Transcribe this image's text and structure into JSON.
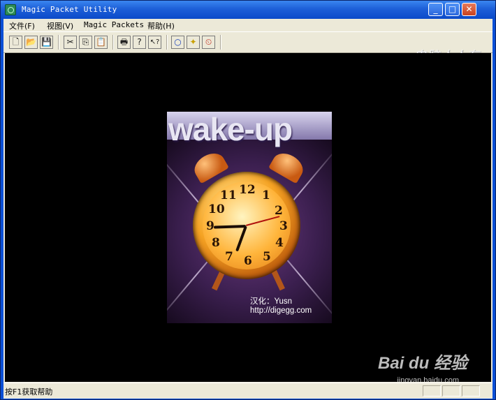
{
  "window": {
    "title": "Magic Packet Utility",
    "controls": {
      "minimize": "_",
      "maximize": "□",
      "close": "✕"
    }
  },
  "menubar": {
    "items": [
      "文件(F)",
      "视图(V)",
      "Magic Packets",
      "帮助(H)"
    ]
  },
  "toolbar": {
    "buttons": [
      {
        "name": "new-file-icon",
        "glyph": "🗋"
      },
      {
        "name": "open-folder-icon",
        "glyph": "📂"
      },
      {
        "name": "save-icon",
        "glyph": "💾"
      },
      {
        "name": "cut-icon",
        "glyph": "✂"
      },
      {
        "name": "copy-icon",
        "glyph": "⎘"
      },
      {
        "name": "paste-icon",
        "glyph": "📋"
      },
      {
        "name": "print-icon",
        "glyph": "🖶"
      },
      {
        "name": "help-icon",
        "glyph": "?"
      },
      {
        "name": "context-help-icon",
        "glyph": "↖?"
      },
      {
        "name": "circle-icon",
        "glyph": "○"
      },
      {
        "name": "wake-icon",
        "glyph": "✦"
      },
      {
        "name": "clock-icon",
        "glyph": "⏲"
      }
    ]
  },
  "watermark": {
    "top_right": "电脑人人有"
  },
  "splash": {
    "headline": "wake-up",
    "clock_numbers": [
      "12",
      "1",
      "2",
      "3",
      "4",
      "5",
      "6",
      "7",
      "8",
      "9",
      "10",
      "11"
    ],
    "credit_line1": "汉化：Yusn",
    "credit_line2": "http://digegg.com"
  },
  "baidu_watermark": {
    "logo": "Bai du 经验",
    "url": "jingyan.baidu.com"
  },
  "status": {
    "text": "按F1获取帮助"
  },
  "colors": {
    "title_blue": "#0b4ac9",
    "chrome": "#ece9d8",
    "view_bg": "#000000"
  }
}
